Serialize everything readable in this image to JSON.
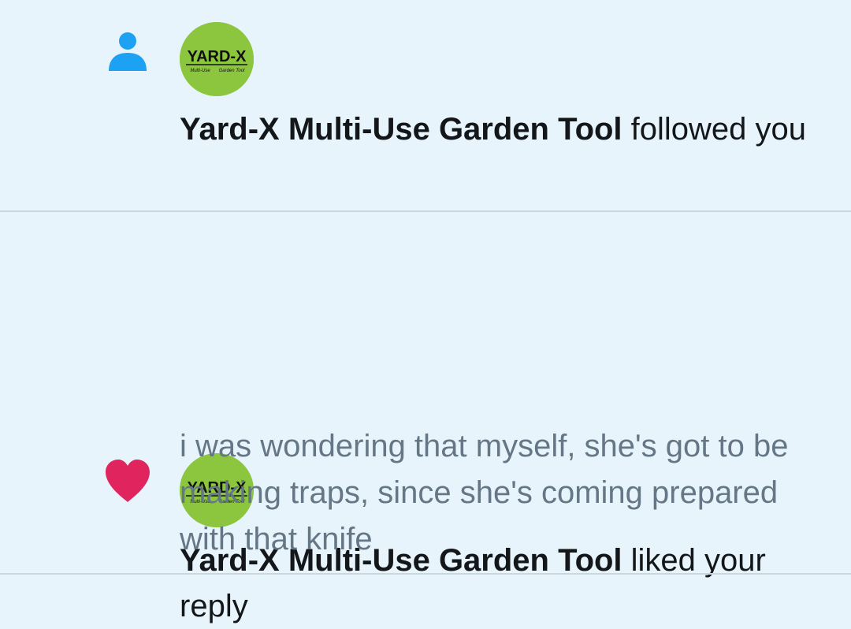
{
  "colors": {
    "background": "#e8f4fb",
    "follow_icon": "#1da1f2",
    "like_icon": "#e0245e",
    "avatar_bg": "#8cc63f",
    "primary_text": "#14171a",
    "secondary_text": "#657786",
    "divider": "#ccd6dd"
  },
  "notifications": [
    {
      "type_icon": "person-icon",
      "avatar": {
        "logo_text": "YARD-X",
        "tagline_left": "Multi-Use",
        "tagline_right": "Garden Tool"
      },
      "user_name": "Yard-X Multi-Use Garden Tool",
      "action": " followed you"
    },
    {
      "type_icon": "heart-icon",
      "avatar": {
        "logo_text": "YARD-X",
        "tagline_left": "Multi-Use",
        "tagline_right": "Garden Tool"
      },
      "user_name": "Yard-X Multi-Use Garden Tool",
      "action": " liked your reply",
      "quoted_text": "i was wondering that myself, she's got to be making traps, since she's coming prepared with that knife"
    }
  ]
}
